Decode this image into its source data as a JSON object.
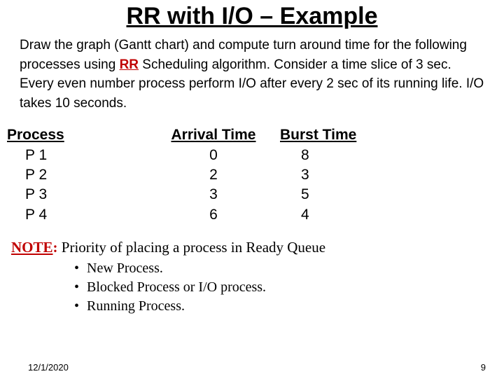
{
  "title": "RR with I/O – Example",
  "prompt_parts": {
    "a": "Draw the graph (Gantt chart)  and compute turn around time for the following processes using ",
    "rr": "RR",
    "b": " Scheduling algorithm. Consider a time slice of 3 sec. Every even number process perform I/O after every 2 sec of its running life. I/O takes 10 seconds."
  },
  "table": {
    "headers": {
      "process": "Process",
      "arrival": "Arrival Time",
      "burst": "Burst Time"
    },
    "rows": [
      {
        "process": "P 1",
        "arrival": "0",
        "burst": "8"
      },
      {
        "process": "P 2",
        "arrival": "2",
        "burst": "3"
      },
      {
        "process": "P 3",
        "arrival": "3",
        "burst": "5"
      },
      {
        "process": "P 4",
        "arrival": "6",
        "burst": "4"
      }
    ]
  },
  "note": {
    "label": "NOTE",
    "colon": ":",
    "text": " Priority of placing a process in Ready Queue",
    "items": [
      "New Process.",
      "Blocked Process or I/O process.",
      "Running Process."
    ]
  },
  "footer": {
    "date": "12/1/2020",
    "page": "9"
  },
  "chart_data": {
    "type": "table",
    "columns": [
      "Process",
      "Arrival Time",
      "Burst Time"
    ],
    "rows": [
      [
        "P1",
        0,
        8
      ],
      [
        "P2",
        2,
        3
      ],
      [
        "P3",
        3,
        5
      ],
      [
        "P4",
        6,
        4
      ]
    ],
    "time_slice_sec": 3,
    "io_rule": "Even-numbered processes perform I/O after every 2 sec of running; I/O takes 10 sec",
    "title": "RR with I/O – Example"
  }
}
